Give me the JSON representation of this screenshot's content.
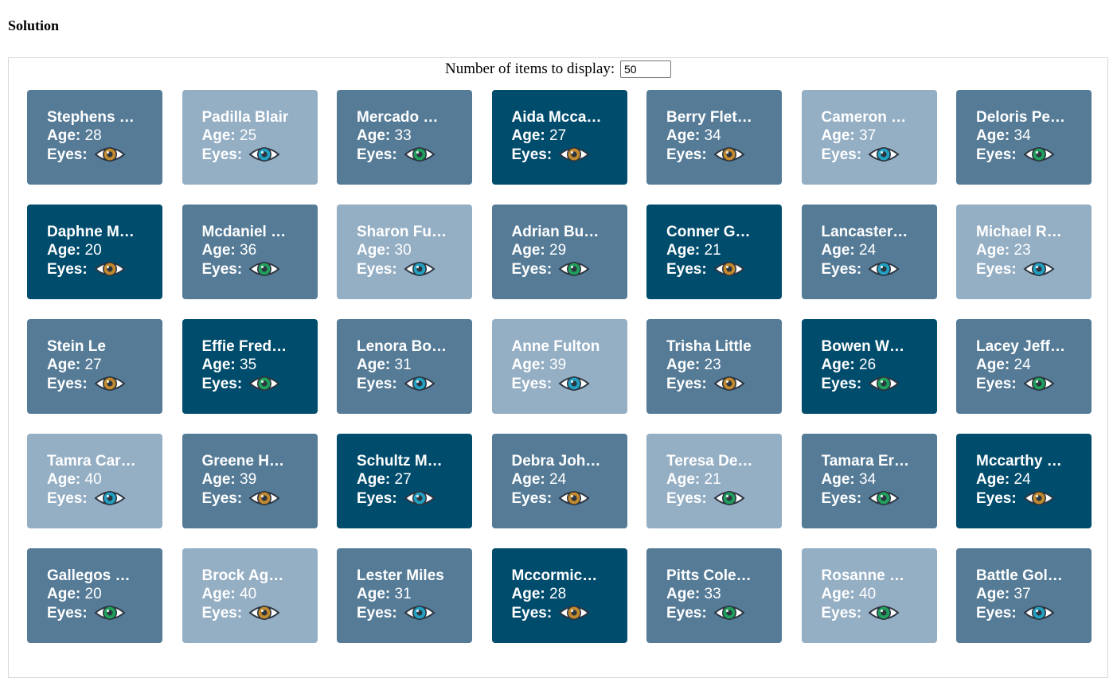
{
  "page": {
    "title": "Solution"
  },
  "controls": {
    "label": "Number of items to display:",
    "count_value": "50"
  },
  "labels": {
    "age": "Age:",
    "eyes": "Eyes:"
  },
  "eye_colors": {
    "brown": "#c28a2d",
    "blue": "#22a1c3",
    "green": "#1fa05c"
  },
  "people": [
    {
      "name": "Stephens …",
      "age": "28",
      "eyes": "brown",
      "shade": 1
    },
    {
      "name": "Padilla Blair",
      "age": "25",
      "eyes": "blue",
      "shade": 2
    },
    {
      "name": "Mercado …",
      "age": "33",
      "eyes": "green",
      "shade": 1
    },
    {
      "name": "Aida Mcca…",
      "age": "27",
      "eyes": "brown",
      "shade": 0
    },
    {
      "name": "Berry Flet…",
      "age": "34",
      "eyes": "brown",
      "shade": 1
    },
    {
      "name": "Cameron …",
      "age": "37",
      "eyes": "blue",
      "shade": 2
    },
    {
      "name": "Deloris Pe…",
      "age": "34",
      "eyes": "green",
      "shade": 1
    },
    {
      "name": "Daphne M…",
      "age": "20",
      "eyes": "brown",
      "shade": 0
    },
    {
      "name": "Mcdaniel …",
      "age": "36",
      "eyes": "green",
      "shade": 1
    },
    {
      "name": "Sharon Fu…",
      "age": "30",
      "eyes": "blue",
      "shade": 2
    },
    {
      "name": "Adrian Bu…",
      "age": "29",
      "eyes": "green",
      "shade": 1
    },
    {
      "name": "Conner G…",
      "age": "21",
      "eyes": "brown",
      "shade": 0
    },
    {
      "name": "Lancaster…",
      "age": "24",
      "eyes": "blue",
      "shade": 1
    },
    {
      "name": "Michael R…",
      "age": "23",
      "eyes": "blue",
      "shade": 2
    },
    {
      "name": "Stein Le",
      "age": "27",
      "eyes": "brown",
      "shade": 1
    },
    {
      "name": "Effie Fred…",
      "age": "35",
      "eyes": "green",
      "shade": 0
    },
    {
      "name": "Lenora Bo…",
      "age": "31",
      "eyes": "blue",
      "shade": 1
    },
    {
      "name": "Anne Fulton",
      "age": "39",
      "eyes": "blue",
      "shade": 2
    },
    {
      "name": "Trisha Little",
      "age": "23",
      "eyes": "brown",
      "shade": 1
    },
    {
      "name": "Bowen W…",
      "age": "26",
      "eyes": "green",
      "shade": 0
    },
    {
      "name": "Lacey Jeff…",
      "age": "24",
      "eyes": "green",
      "shade": 1
    },
    {
      "name": "Tamra Car…",
      "age": "40",
      "eyes": "blue",
      "shade": 2
    },
    {
      "name": "Greene H…",
      "age": "39",
      "eyes": "brown",
      "shade": 1
    },
    {
      "name": "Schultz M…",
      "age": "27",
      "eyes": "blue",
      "shade": 0
    },
    {
      "name": "Debra Joh…",
      "age": "24",
      "eyes": "brown",
      "shade": 1
    },
    {
      "name": "Teresa De…",
      "age": "21",
      "eyes": "green",
      "shade": 2
    },
    {
      "name": "Tamara Er…",
      "age": "34",
      "eyes": "green",
      "shade": 1
    },
    {
      "name": "Mccarthy …",
      "age": "24",
      "eyes": "brown",
      "shade": 0
    },
    {
      "name": "Gallegos …",
      "age": "20",
      "eyes": "green",
      "shade": 1
    },
    {
      "name": "Brock Ag…",
      "age": "40",
      "eyes": "brown",
      "shade": 2
    },
    {
      "name": "Lester Miles",
      "age": "31",
      "eyes": "blue",
      "shade": 1
    },
    {
      "name": "Mccormic…",
      "age": "28",
      "eyes": "brown",
      "shade": 0
    },
    {
      "name": "Pitts Cole…",
      "age": "33",
      "eyes": "green",
      "shade": 1
    },
    {
      "name": "Rosanne …",
      "age": "40",
      "eyes": "green",
      "shade": 2
    },
    {
      "name": "Battle Gol…",
      "age": "37",
      "eyes": "blue",
      "shade": 1
    }
  ]
}
